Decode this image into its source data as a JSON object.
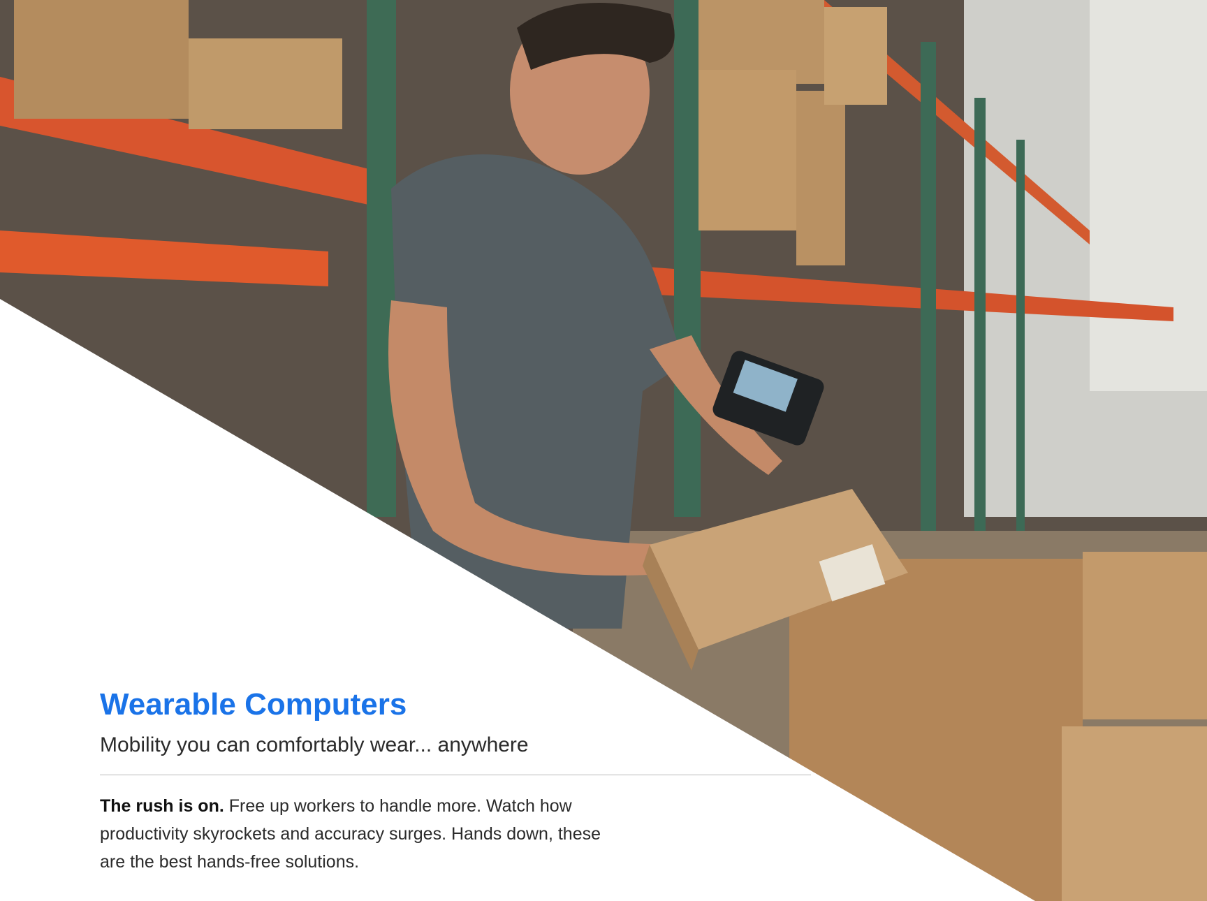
{
  "hero": {
    "photo_description_icon": "warehouse-worker-photo"
  },
  "content": {
    "title": "Wearable Computers",
    "subtitle": "Mobility you can comfortably wear... anywhere",
    "lead": "The rush is on.",
    "body": " Free up workers to handle more. Watch how productivity skyrockets and accuracy surges. Hands down, these are the best hands-free solutions."
  },
  "colors": {
    "accent": "#1a73e8",
    "text": "#2b2b2b",
    "divider": "#b8b8b8"
  }
}
